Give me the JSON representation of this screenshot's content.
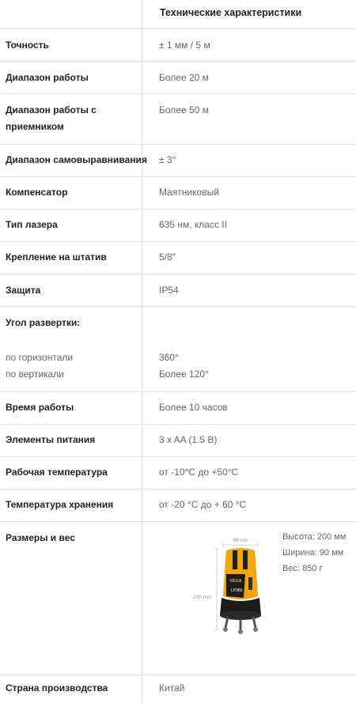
{
  "header": "Технические характеристики",
  "rows": [
    {
      "label": "Точность",
      "value": "± 1 мм / 5 м"
    },
    {
      "label": "Диапазон работы",
      "value": "Более 20 м"
    },
    {
      "label_line1": "Диапазон работы с",
      "label_line2": "приемником",
      "value": "Более 50 м"
    },
    {
      "label": "Диапазон самовыравнивания",
      "value": "± 3°"
    },
    {
      "label": "Компенсатор",
      "value": "Маятниковый"
    },
    {
      "label": "Тип лазера",
      "value": "635 нм, класс II"
    },
    {
      "label": "Крепление на штатив",
      "value": "5/8\""
    },
    {
      "label": "Защита",
      "value": "IP54"
    },
    {
      "label": "Угол развертки:",
      "sub": [
        {
          "label": "по горизонтали",
          "value": "360°"
        },
        {
          "label": "по вертикали",
          "value": "Более 120°"
        }
      ]
    },
    {
      "label": "Время работы",
      "value": "Более 10 часов"
    },
    {
      "label": "Элементы питания",
      "value": "3 x AA (1.5 В)"
    },
    {
      "label": "Рабочая температура",
      "value": "от -10°C до +50°C"
    },
    {
      "label": "Температура хранения",
      "value": "от -20 °C до + 60 °C"
    },
    {
      "label": "Размеры и вес"
    },
    {
      "label": "Страна производства",
      "value": "Китай"
    }
  ],
  "dimensions": {
    "height": "Высота: 200 мм",
    "width": "Ширина: 90 мм",
    "weight": "Вес: 850 г",
    "fig_width": "90 mm",
    "fig_height": "200 mm",
    "brand": "VEGA",
    "model": "LP360"
  },
  "colors": {
    "device_body": "#f2a50f",
    "device_dark": "#1b1b1b",
    "grid": "#e1e1e1",
    "value_text": "#666666"
  }
}
